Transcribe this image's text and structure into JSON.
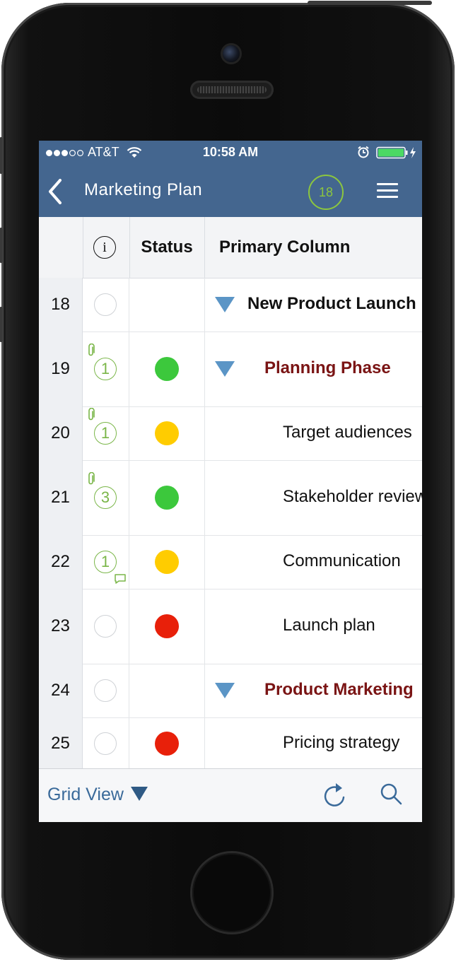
{
  "status_bar": {
    "carrier": "AT&T",
    "time": "10:58 AM",
    "signal_icon": "signal-dots-icon",
    "wifi_icon": "wifi-icon",
    "alarm_icon": "alarm-clock-icon",
    "battery_icon": "battery-charging-icon"
  },
  "nav": {
    "title": "Marketing  Plan",
    "badge_count": "18",
    "back_icon": "chevron-left-icon",
    "menu_icon": "hamburger-menu-icon"
  },
  "columns": {
    "info_icon": "info-icon",
    "status": "Status",
    "primary": "Primary Column"
  },
  "rows": [
    {
      "num": "18",
      "info": "",
      "attachment": false,
      "comment": false,
      "status": "",
      "text": "New Product Launch",
      "style": "bold",
      "toggle": true
    },
    {
      "num": "19",
      "info": "1",
      "attachment": true,
      "comment": false,
      "status": "green",
      "text": "Planning Phase",
      "style": "maroon",
      "toggle": true
    },
    {
      "num": "20",
      "info": "1",
      "attachment": true,
      "comment": false,
      "status": "yellow",
      "text": "Target audiences",
      "style": "normal",
      "toggle": false
    },
    {
      "num": "21",
      "info": "3",
      "attachment": true,
      "comment": false,
      "status": "green",
      "text": "Stakeholder review",
      "style": "normal",
      "toggle": false
    },
    {
      "num": "22",
      "info": "1",
      "attachment": false,
      "comment": true,
      "status": "yellow",
      "text": "Communication",
      "style": "normal",
      "toggle": false
    },
    {
      "num": "23",
      "info": "",
      "attachment": false,
      "comment": false,
      "status": "red",
      "text": "Launch plan",
      "style": "normal",
      "toggle": false
    },
    {
      "num": "24",
      "info": "",
      "attachment": false,
      "comment": false,
      "status": "",
      "text": "Product Marketing",
      "style": "maroon",
      "toggle": true
    },
    {
      "num": "25",
      "info": "",
      "attachment": false,
      "comment": false,
      "status": "red",
      "text": "Pricing strategy",
      "style": "normal",
      "toggle": false
    }
  ],
  "status_colors": {
    "green": "#3cc83c",
    "yellow": "#ffcc00",
    "red": "#e8200a"
  },
  "colors": {
    "navbar": "#44668f",
    "accent_green": "#8cc63f",
    "toggle_blue": "#5b95c6",
    "maroon": "#7a1414"
  },
  "toolbar": {
    "view_label": "Grid View",
    "caret_icon": "caret-down-icon",
    "refresh_icon": "refresh-icon",
    "search_icon": "search-icon"
  }
}
